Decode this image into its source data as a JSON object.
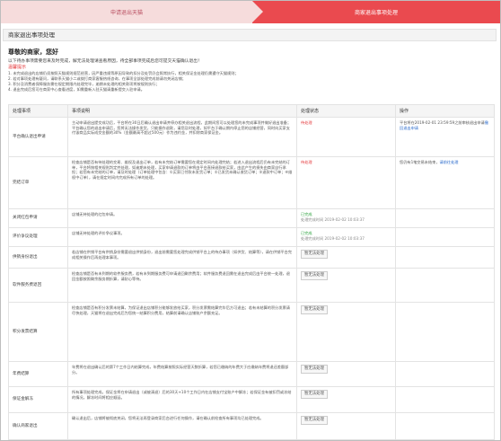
{
  "steps": [
    "申请退出天猫",
    "商家退出事项处理"
  ],
  "header": {
    "title": "商家退出事项处理"
  },
  "greeting": "尊敬的商家，您好",
  "intro": "以下待办事项需要您来及时完成，解无法处理请查看原因，待全部事项完成后您可提交天猫确认退出！",
  "notice": {
    "title": "温馨提示",
    "items": [
      "1. 未完成退出的店铺仍须按照天猫规则规范经营，因严重违规等原因导致的扣分及处罚仍会照常执行，相关保证金处理仍需遵守天猫规则；",
      "2. 若对事项处理有疑问，请联系天猫小二或拨打商家客服热线咨询，在事项全部处理完成前请勿关闭店铺；",
      "3. 积分及消费者保障服务需在规定期限内处理完毕，逾期未处理的相关款项将按规则执行；",
      "4. 退出完成后您可在商家中心查看进度，如需重新入驻天猫请重新提交入驻申请。"
    ]
  },
  "table": {
    "headers": [
      "处理事项",
      "事项说明",
      "处理状态",
      "操作"
    ],
    "rows": [
      {
        "item": "平台确认退出申请",
        "desc": "主动申请退出提交成功后，平台将在30日后确认退出申请并停办相关退出流程，此期间您可以处理您的未完成事项并做好退出准备；平台确认您的退出申请后，您将无法操作发货，只能操作退款，请您及时处理，如平台于确认期内停止您的店铺经营，同时向买家支付该商品实际成交金额的30%（金额最高不超过500元）作为违约金，并扣除商家保证金。",
        "status": "待处理",
        "status_sub": "",
        "status_color": "red",
        "op": "平台将在2019-02-01 23:59:59之前审核退出申请",
        "op_link": "撤回退出申请"
      },
      {
        "item": "完结订单",
        "desc": "检查店铺是否有待处理的交易、维权及退出订单，若有未完结订单需要您在规定时间内处理完结；若进入退出流程后仍有未完结的订单，平台将按相关规则判定并处理，如逾期未处理，买家申请退款的订单将由平台直接退款给买家，由此产生的损失由商家自行承担；若您有未完结的订单，请及时处理（订单处理中包含：①买家已付款未发货订单；②已发货未确认收货订单；③退款中订单；④维权中订单），请在规定时间内完成所有订单的处理。",
        "status": "待处理",
        "status_sub": "",
        "status_color": "red",
        "op": "您仍有1笔交易未结束，",
        "op_link": "请前往处理"
      },
      {
        "item": "关闭红包申请",
        "desc": "店铺无待处理的红包申请。",
        "status": "已完成",
        "status_sub": "处理完成时间 2019-02-02 10:03:37",
        "status_color": "green",
        "op": "",
        "op_link": ""
      },
      {
        "item": "评价争议处理",
        "desc": "店铺无待处理的评价争议事项。",
        "status": "已完成",
        "status_sub": "处理完成时间 2019-02-02 10:03:37",
        "status_color": "green",
        "op": "",
        "op_link": ""
      },
      {
        "item": "供销身份退出",
        "desc": "若店铺在供销平台有供销身份需要退出供销身份，退出前需要您处理完成供销平台上的待办事项（如供货、结算等），请在供销平台完成相关操作后再处理本事项。",
        "status": "暂无法处理",
        "status_sub": "",
        "status_color": "btn",
        "op": "",
        "op_link": ""
      },
      {
        "item": "软件服务费退回",
        "desc": "检查店铺是否有未到期的软件服务费，若有未到期服务费可申请退回剩余费用；软件服务费退回需在退出完成后由平台统一处理，退回金额按照剩余服务期折算，请耐心等待。",
        "status": "暂无法处理",
        "status_sub": "",
        "status_color": "btn",
        "op": "",
        "op_link": ""
      },
      {
        "item": "积分发票结算",
        "desc": "检查店铺是否有积分发票未结算，为保证退出店铺积分能够发放给买家，积分发票需结算完毕后方可退出；若有未结算的积分发票请尽快处理，天猫将在退出完成后为您统一结算积分费用，结算前请确认店铺账户余额充足。",
        "status": "暂无法处理",
        "status_sub": "",
        "status_color": "btn",
        "op": "",
        "op_link": ""
      },
      {
        "item": "年费结算",
        "desc": "年费将在退出确认后的第7个工作日内结算完成，年费结算按照实际经营天数折算，若您已缴纳的年费大于应缴纳年费将退还差额部分。",
        "status": "暂无法处理",
        "status_sub": "",
        "status_color": "btn",
        "op": "",
        "op_link": ""
      },
      {
        "item": "保证金解冻",
        "desc": "所有事项处理完成，保证金将在申请退出（或被清退）后的30天+10个工作日内在店铺支付宝账户中解冻；若保证金有被扣罚或冻结的情况，解冻时间将相应顺延。",
        "status": "暂无法处理",
        "status_sub": "",
        "status_color": "btn",
        "op": "",
        "op_link": ""
      },
      {
        "item": "确认商家退出",
        "desc": "确认退出后，店铺将被彻底关闭，您将无法再登录商家后台进行任何操作，请在确认前检查所有事项均已处理完成。",
        "status": "暂无法处理",
        "status_sub": "",
        "status_color": "btn",
        "op": "",
        "op_link": ""
      }
    ]
  }
}
